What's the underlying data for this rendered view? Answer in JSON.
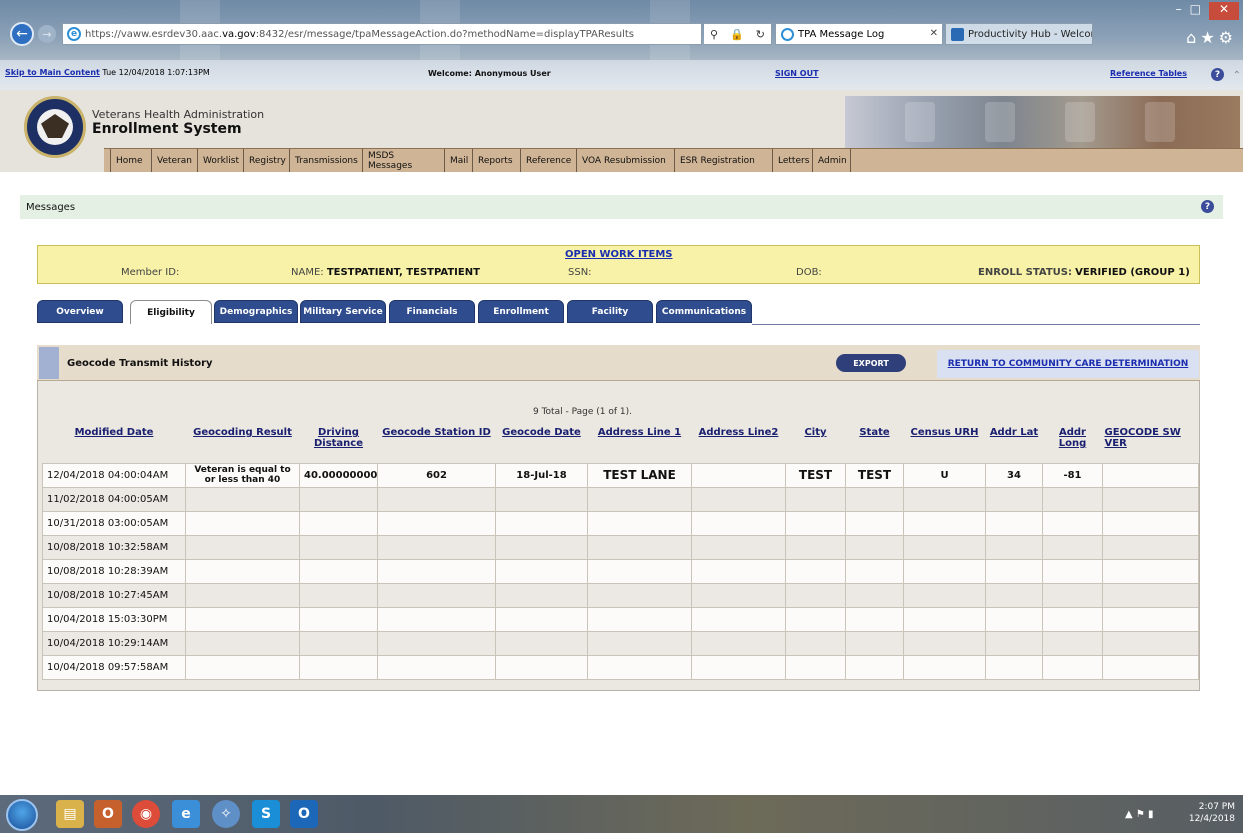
{
  "browser": {
    "url_prefix": "https://",
    "url_dim1": "vaww.esrdev30.aac.",
    "url_bold": "va.gov",
    "url_rest": ":8432/esr/message/tpaMessageAction.do?methodName=displayTPAResults",
    "tabs": [
      {
        "title": "TPA Message Log"
      },
      {
        "title": "Productivity Hub - Welcome to..."
      }
    ]
  },
  "topbar": {
    "skip_link": "Skip to Main Content",
    "datetime": "Tue 12/04/2018 1:07:13PM",
    "welcome": "Welcome: Anonymous User",
    "signout": "SIGN OUT",
    "reference_tables": "Reference Tables"
  },
  "header": {
    "org": "Veterans Health Administration",
    "system": "Enrollment System"
  },
  "nav": [
    "Home",
    "Veteran",
    "Worklist",
    "Registry",
    "Transmissions",
    "MSDS Messages",
    "Mail",
    "Reports",
    "Reference",
    "VOA Resubmission",
    "ESR Registration",
    "Letters",
    "Admin"
  ],
  "messages_title": "Messages",
  "member": {
    "open_work_items": "OPEN WORK ITEMS",
    "member_id_label": "Member ID:",
    "name_label": "NAME:",
    "name_value": "TESTPATIENT, TESTPATIENT",
    "ssn_label": "SSN:",
    "dob_label": "DOB:",
    "enroll_status_label": "ENROLL STATUS:",
    "enroll_status_value": "VERIFIED (GROUP 1)"
  },
  "subtabs": [
    "Overview",
    "Eligibility",
    "Demographics",
    "Military Service",
    "Financials",
    "Enrollment",
    "Facility",
    "Communications"
  ],
  "panel": {
    "title": "Geocode Transmit History",
    "export": "EXPORT",
    "return_link": "RETURN TO COMMUNITY CARE DETERMINATION",
    "pager": "9 Total - Page (1 of 1)."
  },
  "table": {
    "headers": [
      "Modified Date",
      "Geocoding Result",
      "Driving Distance",
      "Geocode Station ID",
      "Geocode Date",
      "Address Line 1",
      "Address Line2",
      "City",
      "State",
      "Census URH",
      "Addr Lat",
      "Addr Long",
      "GEOCODE SW VER"
    ],
    "rows": [
      [
        "12/04/2018 04:00:04AM",
        "Veteran is equal to or less than 40",
        "40.00000000",
        "602",
        "18-Jul-18",
        "TEST LANE",
        "",
        "TEST",
        "TEST",
        "U",
        "34",
        "-81",
        ""
      ],
      [
        "11/02/2018 04:00:05AM",
        "",
        "",
        "",
        "",
        "",
        "",
        "",
        "",
        "",
        "",
        "",
        ""
      ],
      [
        "10/31/2018 03:00:05AM",
        "",
        "",
        "",
        "",
        "",
        "",
        "",
        "",
        "",
        "",
        "",
        ""
      ],
      [
        "10/08/2018 10:32:58AM",
        "",
        "",
        "",
        "",
        "",
        "",
        "",
        "",
        "",
        "",
        "",
        ""
      ],
      [
        "10/08/2018 10:28:39AM",
        "",
        "",
        "",
        "",
        "",
        "",
        "",
        "",
        "",
        "",
        "",
        ""
      ],
      [
        "10/08/2018 10:27:45AM",
        "",
        "",
        "",
        "",
        "",
        "",
        "",
        "",
        "",
        "",
        "",
        ""
      ],
      [
        "10/04/2018 15:03:30PM",
        "",
        "",
        "",
        "",
        "",
        "",
        "",
        "",
        "",
        "",
        "",
        ""
      ],
      [
        "10/04/2018 10:29:14AM",
        "",
        "",
        "",
        "",
        "",
        "",
        "",
        "",
        "",
        "",
        "",
        ""
      ],
      [
        "10/04/2018 09:57:58AM",
        "",
        "",
        "",
        "",
        "",
        "",
        "",
        "",
        "",
        "",
        "",
        ""
      ]
    ]
  },
  "taskbar": {
    "time": "2:07 PM",
    "date": "12/4/2018"
  },
  "colors": {
    "nav_bg": "#cfb495",
    "tab_blue": "#2f4d8e",
    "member_bar": "#f7f2a7",
    "link_blue": "#1a2dae"
  }
}
